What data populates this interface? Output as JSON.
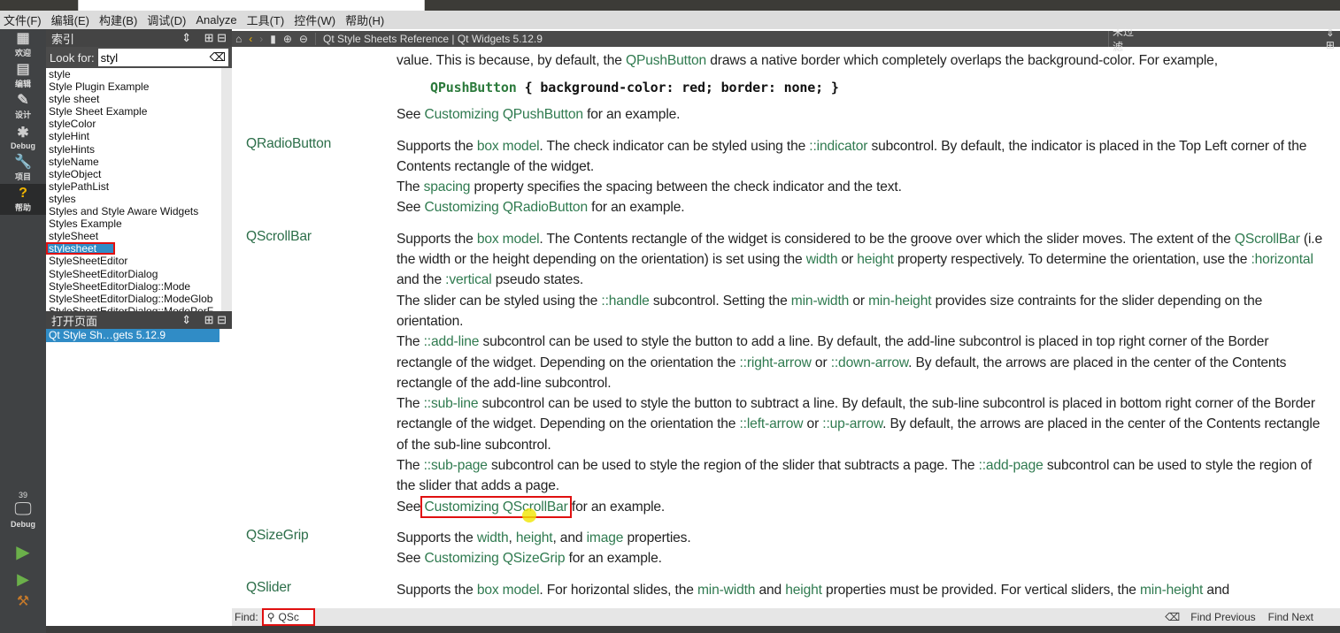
{
  "menubar": [
    "文件(F)",
    "编辑(E)",
    "构建(B)",
    "调试(D)",
    "Analyze",
    "工具(T)",
    "控件(W)",
    "帮助(H)"
  ],
  "modes": [
    {
      "label": "欢迎",
      "icon": "grid-icon"
    },
    {
      "label": "编辑",
      "icon": "document-icon"
    },
    {
      "label": "设计",
      "icon": "pencil-icon"
    },
    {
      "label": "Debug",
      "icon": "bug-icon"
    },
    {
      "label": "项目",
      "icon": "wrench-icon"
    },
    {
      "label": "帮助",
      "icon": "help-icon",
      "active": true
    }
  ],
  "kit": {
    "count": "39",
    "label": "Debug"
  },
  "sidebar": {
    "index_title": "索引",
    "look_for_label": "Look for:",
    "look_for_value": "styl",
    "items": [
      "style",
      "Style Plugin Example",
      "style sheet",
      "Style Sheet Example",
      "styleColor",
      "styleHint",
      "styleHints",
      "styleName",
      "styleObject",
      "stylePathList",
      "styles",
      "Styles and Style Aware Widgets",
      "Styles Example",
      "styleSheet",
      "stylesheet",
      "StyleSheetEditor",
      "StyleSheetEditorDialog",
      "StyleSheetEditorDialog::Mode",
      "StyleSheetEditorDialog::ModeGlob",
      "StyleSheetEditorDialog::ModePerF"
    ],
    "selected_index": 14,
    "open_pages_title": "打开页面",
    "open_pages": [
      "Qt Style Sh…gets 5.12.9"
    ]
  },
  "toolbar": {
    "page_title": "Qt Style Sheets Reference | Qt Widgets 5.12.9",
    "filter": "未过滤"
  },
  "content": [
    {
      "term": "",
      "paras": [
        [
          [
            "value. This is because, by default, the "
          ],
          [
            "QPushButton",
            "l"
          ],
          [
            " draws a native border which completely overlaps the background-color. For example,"
          ]
        ]
      ],
      "code": [
        "QPushButton",
        " { background-color: red; border: none; }"
      ],
      "after": [
        [
          [
            "See "
          ],
          [
            "Customizing QPushButton",
            "l"
          ],
          [
            " for an example."
          ]
        ]
      ]
    },
    {
      "term": "QRadioButton",
      "paras": [
        [
          [
            "Supports the "
          ],
          [
            "box model",
            "l"
          ],
          [
            ". The check indicator can be styled using the "
          ],
          [
            "::indicator",
            "l"
          ],
          [
            " subcontrol. By default, the indicator is placed in the Top Left corner of the Contents rectangle of the widget."
          ]
        ],
        [
          [
            "The "
          ],
          [
            "spacing",
            "l"
          ],
          [
            " property specifies the spacing between the check indicator and the text."
          ]
        ],
        [
          [
            "See "
          ],
          [
            "Customizing QRadioButton",
            "l"
          ],
          [
            " for an example."
          ]
        ]
      ]
    },
    {
      "term": "QScrollBar",
      "paras": [
        [
          [
            "Supports the "
          ],
          [
            "box model",
            "l"
          ],
          [
            ". The Contents rectangle of the widget is considered to be the groove over which the slider moves. The extent of the "
          ],
          [
            "QScrollBar",
            "l"
          ],
          [
            " (i.e the width or the height depending on the orientation) is set using the "
          ],
          [
            "width",
            "l"
          ],
          [
            " or "
          ],
          [
            "height",
            "l"
          ],
          [
            " property respectively. To determine the orientation, use the "
          ],
          [
            ":horizontal",
            "l"
          ],
          [
            " and the "
          ],
          [
            ":vertical",
            "l"
          ],
          [
            " pseudo states."
          ]
        ],
        [
          [
            "The slider can be styled using the "
          ],
          [
            "::handle",
            "l"
          ],
          [
            " subcontrol. Setting the "
          ],
          [
            "min-width",
            "l"
          ],
          [
            " or "
          ],
          [
            "min-height",
            "l"
          ],
          [
            " provides size contraints for the slider depending on the orientation."
          ]
        ],
        [
          [
            "The "
          ],
          [
            "::add-line",
            "l"
          ],
          [
            " subcontrol can be used to style the button to add a line. By default, the add-line subcontrol is placed in top right corner of the Border rectangle of the widget. Depending on the orientation the "
          ],
          [
            "::right-arrow",
            "l"
          ],
          [
            " or "
          ],
          [
            "::down-arrow",
            "l"
          ],
          [
            ". By default, the arrows are placed in the center of the Contents rectangle of the add-line subcontrol."
          ]
        ],
        [
          [
            "The "
          ],
          [
            "::sub-line",
            "l"
          ],
          [
            " subcontrol can be used to style the button to subtract a line. By default, the sub-line subcontrol is placed in bottom right corner of the Border rectangle of the widget. Depending on the orientation the "
          ],
          [
            "::left-arrow",
            "l"
          ],
          [
            " or "
          ],
          [
            "::up-arrow",
            "l"
          ],
          [
            ". By default, the arrows are placed in the center of the Contents rectangle of the sub-line subcontrol."
          ]
        ],
        [
          [
            "The "
          ],
          [
            "::sub-page",
            "l"
          ],
          [
            " subcontrol can be used to style the region of the slider that subtracts a page. The "
          ],
          [
            "::add-page",
            "l"
          ],
          [
            " subcontrol can be used to style the region of the slider that adds a page."
          ]
        ],
        [
          [
            "See "
          ],
          [
            "Customizing QScrollBar",
            "lh"
          ],
          [
            " for an example."
          ]
        ]
      ]
    },
    {
      "term": "QSizeGrip",
      "paras": [
        [
          [
            "Supports the "
          ],
          [
            "width",
            "l"
          ],
          [
            ", "
          ],
          [
            "height",
            "l"
          ],
          [
            ", and "
          ],
          [
            "image",
            "l"
          ],
          [
            " properties."
          ]
        ],
        [
          [
            "See "
          ],
          [
            "Customizing QSizeGrip",
            "l"
          ],
          [
            " for an example."
          ]
        ]
      ]
    },
    {
      "term": "QSlider",
      "paras": [
        [
          [
            "Supports the "
          ],
          [
            "box model",
            "l"
          ],
          [
            ". For horizontal slides, the "
          ],
          [
            "min-width",
            "l"
          ],
          [
            " and "
          ],
          [
            "height",
            "l"
          ],
          [
            " properties must be provided. For vertical sliders, the "
          ],
          [
            "min-height",
            "l"
          ],
          [
            " and"
          ]
        ]
      ]
    }
  ],
  "findbar": {
    "label": "Find:",
    "value": "QSc",
    "prev": "Find Previous",
    "next": "Find Next"
  }
}
